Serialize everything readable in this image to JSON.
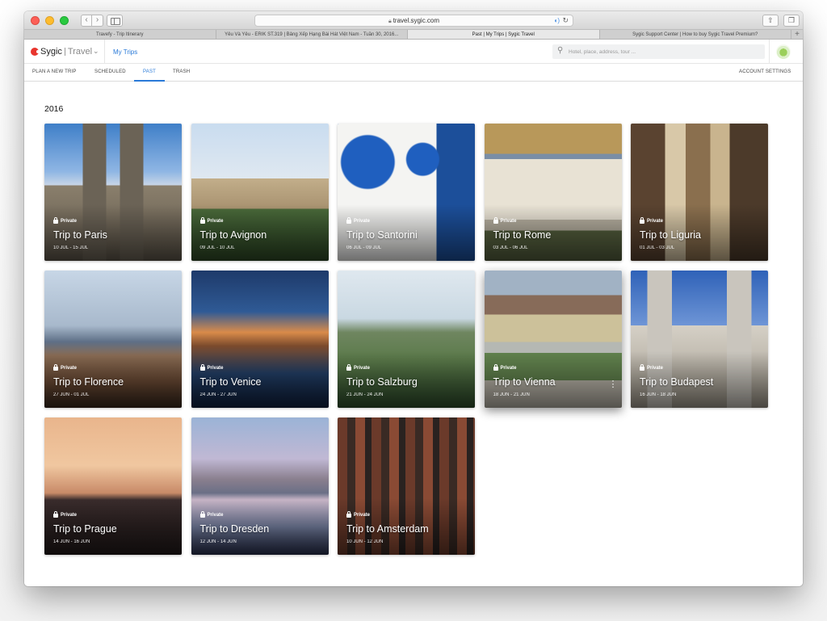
{
  "browser": {
    "url": "travel.sygic.com",
    "tabs": [
      "Travefy - Trip Itinerary",
      "Yêu Và Yêu - ERIK ST.319 | Bảng Xếp Hạng Bài Hát Việt Nam - Tuần 30, 2016...",
      "Past | My Trips | Sygic Travel",
      "Sygic Support Center | How to buy Sygic Travel Premium?"
    ],
    "active_tab": 2
  },
  "header": {
    "logo_brand": "Sygic",
    "logo_product": "Travel",
    "section_link": "My Trips",
    "search_placeholder": "Hotel, place, address, tour ..."
  },
  "subnav": {
    "items": [
      "PLAN A NEW TRIP",
      "SCHEDULED",
      "PAST",
      "TRASH"
    ],
    "active": "PAST",
    "account_settings": "ACCOUNT SETTINGS"
  },
  "year_heading": "2016",
  "private_label": "Private",
  "trips": [
    {
      "title": "Trip to Paris",
      "dates": "10 JUL - 15 JUL",
      "private": true
    },
    {
      "title": "Trip to Avignon",
      "dates": "09 JUL - 10 JUL",
      "private": true
    },
    {
      "title": "Trip to Santorini",
      "dates": "06 JUL - 09 JUL",
      "private": true
    },
    {
      "title": "Trip to Rome",
      "dates": "03 JUL - 06 JUL",
      "private": true
    },
    {
      "title": "Trip to Liguria",
      "dates": "01 JUL - 03 JUL",
      "private": true
    },
    {
      "title": "Trip to Florence",
      "dates": "27 JUN - 01 JUL",
      "private": true
    },
    {
      "title": "Trip to Venice",
      "dates": "24 JUN - 27 JUN",
      "private": true
    },
    {
      "title": "Trip to Salzburg",
      "dates": "21 JUN - 24 JUN",
      "private": true
    },
    {
      "title": "Trip to Vienna",
      "dates": "18 JUN - 21 JUN",
      "private": true,
      "hovered": true
    },
    {
      "title": "Trip to Budapest",
      "dates": "16 JUN - 18 JUN",
      "private": true
    },
    {
      "title": "Trip to Prague",
      "dates": "14 JUN - 16 JUN",
      "private": true
    },
    {
      "title": "Trip to Dresden",
      "dates": "12 JUN - 14 JUN",
      "private": true
    },
    {
      "title": "Trip to Amsterdam",
      "dates": "10 JUN - 12 JUN",
      "private": true
    }
  ],
  "colors": {
    "accent": "#2a7ad8",
    "logo_red": "#e8352e"
  }
}
